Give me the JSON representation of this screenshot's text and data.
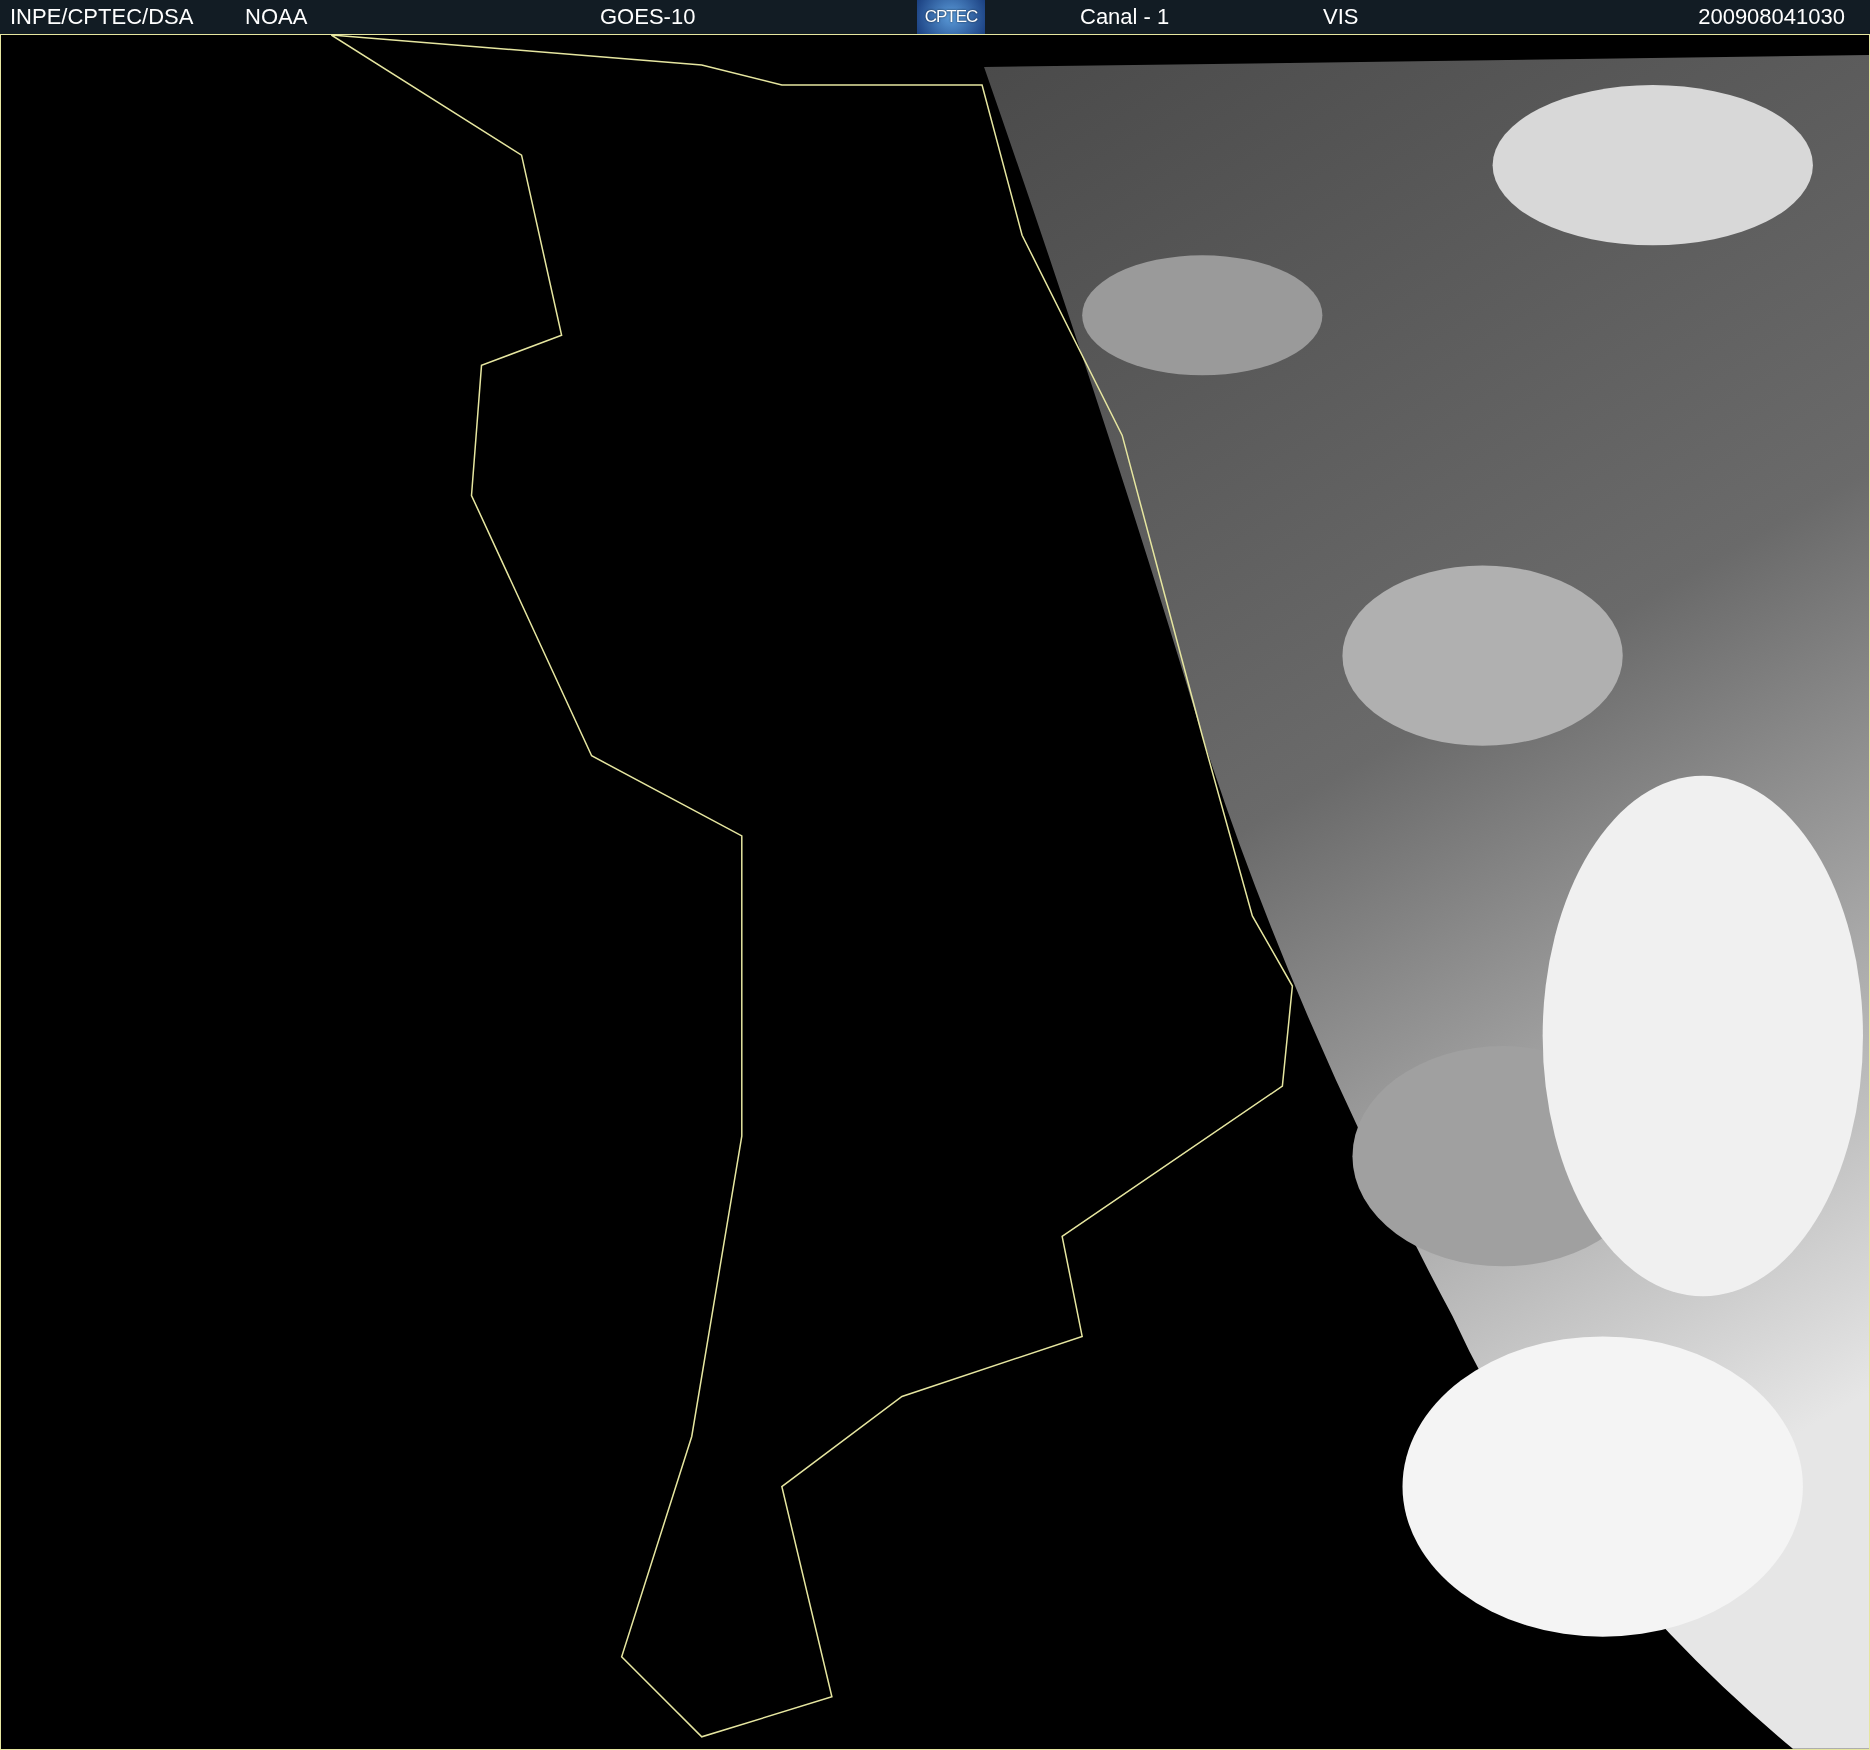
{
  "header": {
    "items": [
      {
        "kind": "text",
        "text": "INPE/CPTEC/DSA"
      },
      {
        "kind": "text",
        "text": "NOAA"
      },
      {
        "kind": "text",
        "text": "GOES-10"
      },
      {
        "kind": "logo",
        "text": "CPTEC"
      },
      {
        "kind": "text",
        "text": "Canal - 1"
      },
      {
        "kind": "text",
        "text": "VIS"
      },
      {
        "kind": "text",
        "text": "200908041030"
      }
    ]
  }
}
